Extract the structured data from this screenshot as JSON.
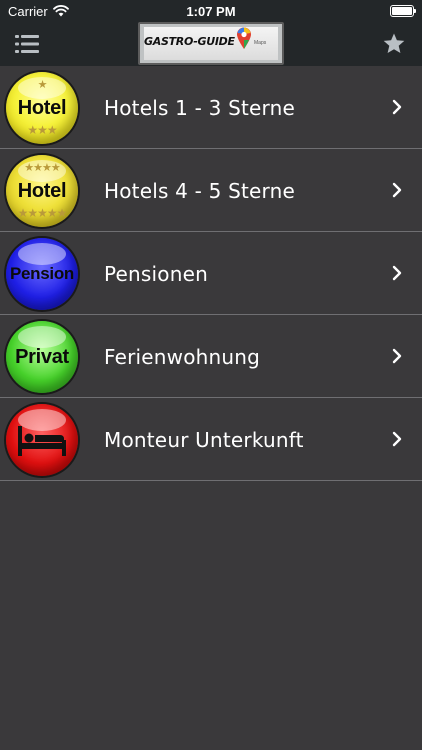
{
  "status_bar": {
    "carrier": "Carrier",
    "time": "1:07 PM"
  },
  "nav": {
    "logo_text": "GASTRO-GUIDE",
    "logo_maps": "Maps",
    "menu_icon": "menu-icon",
    "favorite_icon": "star-icon"
  },
  "list": {
    "items": [
      {
        "label": "Hotels 1 - 3 Sterne",
        "badge_text": "Hotel",
        "stars_top": "★",
        "stars_bottom": "★★★",
        "badge_color": "#f6f23c"
      },
      {
        "label": "Hotels 4 - 5 Sterne",
        "badge_text": "Hotel",
        "stars_top": "★★★★",
        "stars_bottom": "★★★★★",
        "badge_color": "#efe13a"
      },
      {
        "label": "Pensionen",
        "badge_text": "Pension",
        "badge_color": "#1f1fe6"
      },
      {
        "label": "Ferienwohnung",
        "badge_text": "Privat",
        "badge_color": "#46d12a"
      },
      {
        "label": "Monteur Unterkunft",
        "badge_icon": "bed-icon",
        "badge_color": "#e01010"
      }
    ]
  }
}
